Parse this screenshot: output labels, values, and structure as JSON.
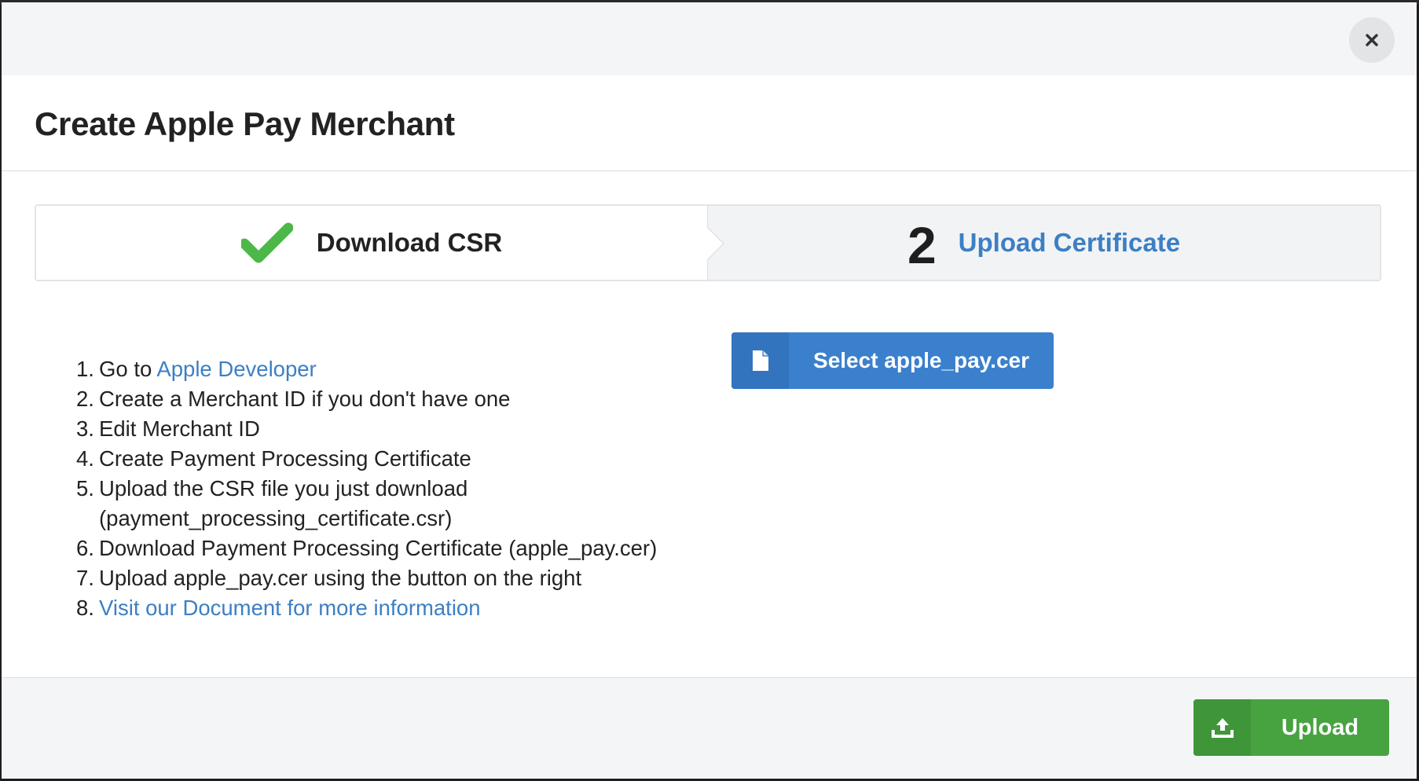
{
  "modal": {
    "title": "Create Apple Pay Merchant",
    "close_icon": "close-icon"
  },
  "steps": [
    {
      "label": "Download CSR",
      "status": "completed",
      "icon": "check-icon"
    },
    {
      "number": "2",
      "label": "Upload Certificate",
      "status": "active"
    }
  ],
  "instructions": [
    {
      "num": "1.",
      "prefix": "Go to ",
      "link": "Apple Developer"
    },
    {
      "num": "2.",
      "text": "Create a Merchant ID if you don't have one"
    },
    {
      "num": "3.",
      "text": "Edit Merchant ID"
    },
    {
      "num": "4.",
      "text": "Create Payment Processing Certificate"
    },
    {
      "num": "5.",
      "text": "Upload the CSR file you just download",
      "text2": "(payment_processing_certificate.csr)"
    },
    {
      "num": "6.",
      "text": "Download Payment Processing Certificate (apple_pay.cer)"
    },
    {
      "num": "7.",
      "text": "Upload apple_pay.cer using the button on the right"
    },
    {
      "num": "8.",
      "link": "Visit our Document for more information"
    }
  ],
  "select_button": {
    "label": "Select apple_pay.cer",
    "icon": "file-icon"
  },
  "footer": {
    "upload_button": {
      "label": "Upload",
      "icon": "upload-icon"
    }
  },
  "colors": {
    "link": "#3c7fc4",
    "primary": "#3a80cc",
    "success": "#47a340",
    "check": "#4cb848"
  }
}
